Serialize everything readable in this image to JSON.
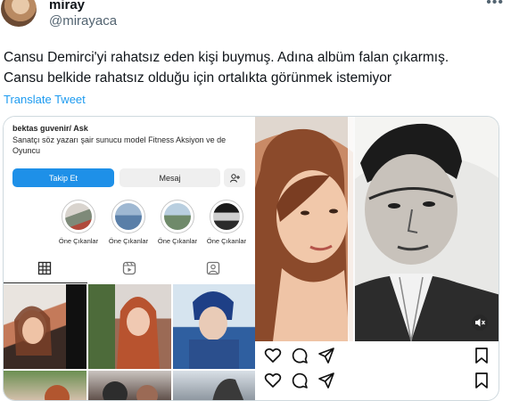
{
  "tweet": {
    "display_name": "miray",
    "handle": "@mirayaca",
    "text_lines": [
      "Cansu Demirci'yi rahatsız eden kişi buymuş. Adına albüm falan çıkarmış.",
      "Cansu belkide rahatsız olduğu için ortalıkta görünmek istemiyor"
    ],
    "translate_label": "Translate Tweet"
  },
  "instagram_profile": {
    "username": "bektas guvenir/ Ask",
    "bio_lines": [
      "Sanatçı söz yazarı şair sunucu model Fitness Aksiyon ve de",
      "Oyuncu"
    ],
    "follow_label": "Takip Et",
    "message_label": "Mesaj",
    "highlights": [
      {
        "label": "Öne Çıkanlar",
        "color": "#7e8a79"
      },
      {
        "label": "Öne Çıkanlar",
        "color": "#5a7fa8"
      },
      {
        "label": "Öne Çıkanlar",
        "color": "#6f8a6a"
      },
      {
        "label": "Öne Çıkanlar",
        "color": "#2b2b2b"
      }
    ]
  },
  "colors": {
    "accent": "#1d9bf0",
    "follow_button": "#1e90e8",
    "secondary_text": "#536471"
  },
  "icons": [
    "more-icon",
    "grid-icon",
    "reels-icon",
    "tagged-icon",
    "add-user-icon",
    "heart-icon",
    "comment-icon",
    "share-icon",
    "bookmark-icon",
    "mute-icon"
  ]
}
